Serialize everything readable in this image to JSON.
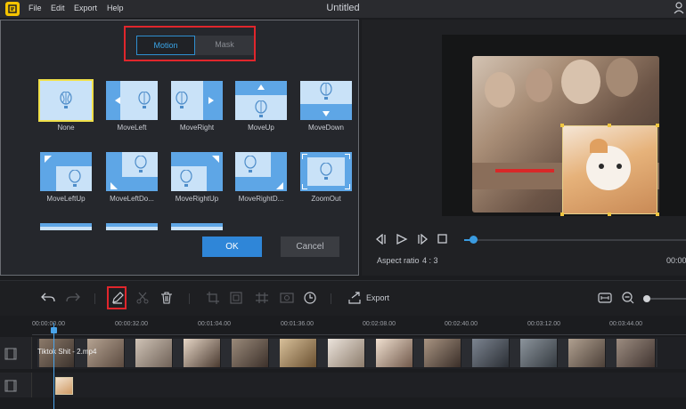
{
  "titlebar": {
    "menus": [
      "File",
      "Edit",
      "Export",
      "Help"
    ],
    "title": "Untitled"
  },
  "dialog": {
    "tabs": [
      "Motion",
      "Mask"
    ],
    "active_tab": "Motion",
    "effects": [
      "None",
      "MoveLeft",
      "MoveRight",
      "MoveUp",
      "MoveDown",
      "MoveLeftUp",
      "MoveLeftDo...",
      "MoveRightUp",
      "MoveRightD...",
      "ZoomOut"
    ],
    "selected_effect": "None",
    "ok_label": "OK",
    "cancel_label": "Cancel"
  },
  "preview": {
    "aspect_label": "Aspect ratio",
    "aspect_value": "4 : 3",
    "time": "00:00"
  },
  "toolbar": {
    "export_label": "Export"
  },
  "timeline": {
    "ticks": [
      "00:00:00.00",
      "00:00:32.00",
      "00:01:04.00",
      "00:01:36.00",
      "00:02:08.00",
      "00:02:40.00",
      "00:03:12.00",
      "00:03:44.00"
    ],
    "clip_name": "Tiktok Shit - 2.mp4"
  },
  "colors": {
    "accent": "#3aa5e8",
    "highlight": "#e0262c",
    "ok_button": "#2f86d8"
  }
}
